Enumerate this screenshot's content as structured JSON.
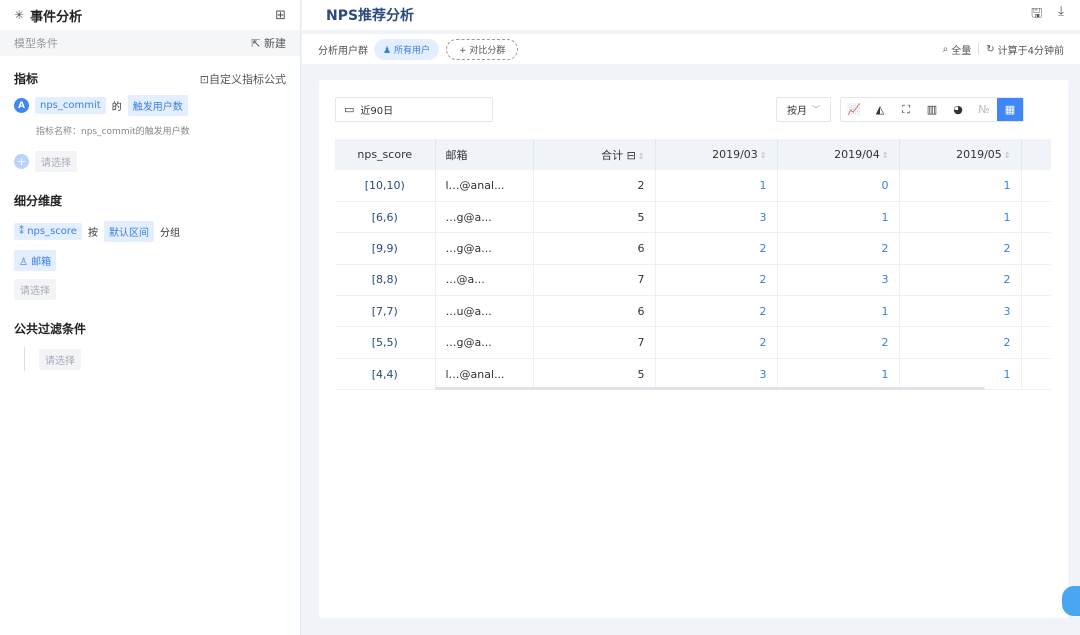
{
  "sidebar": {
    "title": "事件分析",
    "model_label": "模型条件",
    "new_label": "新建",
    "metrics_title": "指标",
    "custom_formula": "自定义指标公式",
    "metric_letter": "A",
    "metric_event": "nps_commit",
    "metric_of": "的",
    "metric_measure": "触发用户数",
    "metric_name_note": "指标名称：nps_commit的触发用户数",
    "select_placeholder": "请选择",
    "breakdown_title": "细分维度",
    "breakdown_field": "nps_score",
    "breakdown_by": "按",
    "breakdown_interval": "默认区间",
    "breakdown_group": "分组",
    "breakdown_second": "邮箱",
    "filter_title": "公共过滤条件"
  },
  "header": {
    "title": "NPS推荐分析"
  },
  "subbar": {
    "group_label": "分析用户群",
    "all_users": "所有用户",
    "compare": "+ 对比分群",
    "full": "全量",
    "computed": "计算于4分钟前"
  },
  "toolbar": {
    "date_range": "近90日",
    "granularity": "按月"
  },
  "table": {
    "columns": [
      "nps_score",
      "邮箱",
      "合计",
      "2019/03",
      "2019/04",
      "2019/05"
    ],
    "rows": [
      {
        "bucket": "[10,10)",
        "email": "l…@anal...",
        "total": "2",
        "m03": "1",
        "m04": "0",
        "m05": "1"
      },
      {
        "bucket": "[6,6)",
        "email": "…g@a...",
        "total": "5",
        "m03": "3",
        "m04": "1",
        "m05": "1"
      },
      {
        "bucket": "[9,9)",
        "email": "…g@a...",
        "total": "6",
        "m03": "2",
        "m04": "2",
        "m05": "2"
      },
      {
        "bucket": "[8,8)",
        "email": "…@a...",
        "total": "7",
        "m03": "2",
        "m04": "3",
        "m05": "2"
      },
      {
        "bucket": "[7,7)",
        "email": "…u@a...",
        "total": "6",
        "m03": "2",
        "m04": "1",
        "m05": "3"
      },
      {
        "bucket": "[5,5)",
        "email": "…g@a...",
        "total": "7",
        "m03": "2",
        "m04": "2",
        "m05": "2"
      },
      {
        "bucket": "[4,4)",
        "email": "l…@anal...",
        "total": "5",
        "m03": "3",
        "m04": "1",
        "m05": "1"
      }
    ]
  },
  "colors": {
    "accent": "#3f86f7",
    "title_blue": "#2c4a7e",
    "tag_bg": "#e3efff"
  }
}
